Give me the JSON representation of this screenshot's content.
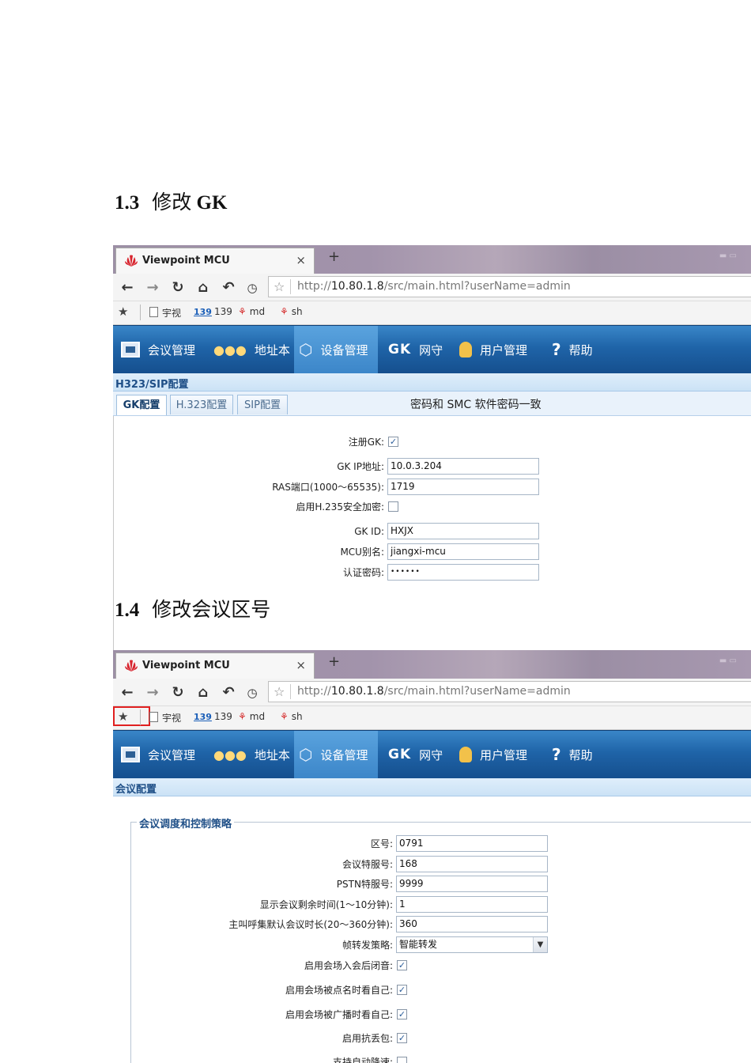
{
  "sections": [
    {
      "number": "1.3",
      "title_cn": "修改",
      "title_en": "GK"
    },
    {
      "number": "1.4",
      "title_cn": "修改会议区号"
    }
  ],
  "browser": {
    "tab_title": "Viewpoint MCU",
    "close_glyph": "×",
    "new_tab_glyph": "+",
    "url_prefix": "http://",
    "url_host": "10.80.1.8",
    "url_path": "/src/main.html?userName=admin",
    "bookmarks": [
      {
        "icon": "page-icon",
        "label": "宇视"
      },
      {
        "icon": "139-icon",
        "badge": "139",
        "label": "139"
      },
      {
        "icon": "weibo-icon",
        "label": "md"
      },
      {
        "icon": "weibo-icon",
        "label": "sh"
      }
    ]
  },
  "nav": {
    "items": [
      {
        "label": "会议管理",
        "icon": "conference-icon"
      },
      {
        "label": "地址本",
        "icon": "users-icon"
      },
      {
        "label": "设备管理",
        "icon": "device-cube-icon",
        "active": true
      },
      {
        "label": "网守",
        "icon": "gk-icon",
        "icon_text": "GK"
      },
      {
        "label": "用户管理",
        "icon": "user-icon"
      },
      {
        "label": "帮助",
        "icon": "help-icon",
        "icon_text": "?"
      }
    ]
  },
  "gk_screen": {
    "section_title": "H323/SIP配置",
    "tabs": [
      "GK配置",
      "H.323配置",
      "SIP配置"
    ],
    "active_tab": "GK配置",
    "note": "密码和 SMC 软件密码一致",
    "fields": {
      "register_gk": {
        "label": "注册GK:",
        "checked": true
      },
      "gk_ip": {
        "label": "GK IP地址:",
        "value": "10.0.3.204"
      },
      "ras_port": {
        "label": "RAS端口(1000～65535):",
        "value": "1719"
      },
      "h235": {
        "label": "启用H.235安全加密:",
        "checked": false
      },
      "gk_id": {
        "label": "GK ID:",
        "value": "HXJX"
      },
      "mcu_alias": {
        "label": "MCU别名:",
        "value": "jiangxi-mcu"
      },
      "auth_password": {
        "label": "认证密码:",
        "value": "••••••"
      }
    }
  },
  "conf_screen": {
    "section_title": "会议配置",
    "group_title": "会议调度和控制策略",
    "fields": {
      "area_code": {
        "label": "区号:",
        "value": "0791"
      },
      "conf_service": {
        "label": "会议特服号:",
        "value": "168"
      },
      "pstn_service": {
        "label": "PSTN特服号:",
        "value": "9999"
      },
      "remaining_time": {
        "label": "显示会议剩余时间(1～10分钟):",
        "value": "1"
      },
      "default_duration": {
        "label": "主叫呼集默认会议时长(20～360分钟):",
        "value": "360"
      },
      "forward_strategy": {
        "label": "帧转发策略:",
        "value": "智能转发"
      },
      "mute_on_join": {
        "label": "启用会场入会后闭音:",
        "checked": true
      },
      "see_self_rollcall": {
        "label": "启用会场被点名时看自己:",
        "checked": true
      },
      "see_self_broadcast": {
        "label": "启用会场被广播时看自己:",
        "checked": true
      },
      "anti_packet_loss": {
        "label": "启用抗丢包:",
        "checked": true
      },
      "auto_rate": {
        "label": "支持自动降速:",
        "checked": false
      }
    }
  }
}
